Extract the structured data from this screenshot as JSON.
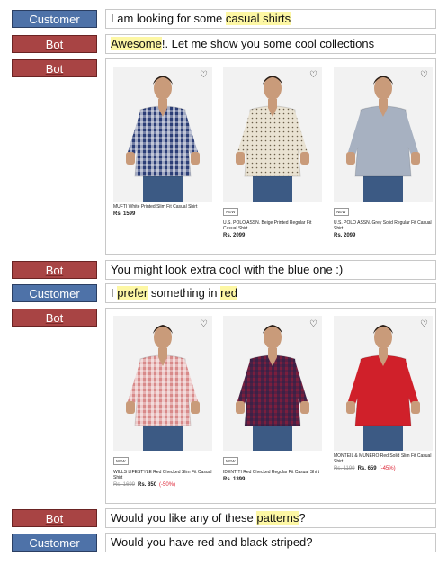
{
  "conversation": [
    {
      "speaker": "Customer",
      "text_parts": [
        "I am looking for some ",
        "casual shirts"
      ]
    },
    {
      "speaker": "Bot",
      "text_parts": [
        "Awesome",
        "!. Let me show you some cool collections"
      ]
    },
    {
      "speaker": "Bot",
      "type": "products"
    },
    {
      "speaker": "Bot",
      "text": "You might look extra cool with the blue one :)"
    },
    {
      "speaker": "Customer",
      "text_parts": [
        "I ",
        "prefer",
        " something in ",
        "red"
      ]
    },
    {
      "speaker": "Bot",
      "type": "products"
    },
    {
      "speaker": "Bot",
      "text_parts": [
        "Would you like any of these ",
        "patterns",
        "?"
      ]
    },
    {
      "speaker": "Customer",
      "text": "Would you have red and black striped?"
    }
  ],
  "products_set1": [
    {
      "name": "MUFTI White Printed Slim Fit Casual Shirt",
      "price": "Rs. 1599",
      "badge": "",
      "shirt_color": "#2c3e77",
      "pattern": "check-blue"
    },
    {
      "name": "U.S. POLO ASSN. Beige Printed Regular Fit Casual Shirt",
      "price": "Rs. 2099",
      "badge": "NEW",
      "shirt_color": "#e9e2d2",
      "pattern": "print-beige"
    },
    {
      "name": "U.S. POLO ASSN. Grey Solid Regular Fit Casual Shirt",
      "price": "Rs. 2099",
      "badge": "NEW",
      "shirt_color": "#a7b1c1",
      "pattern": "solid-grey"
    }
  ],
  "products_set2": [
    {
      "name": "WILLS LIFESTYLE Red Checked Slim Fit Casual Shirt",
      "mrp": "Rs. 1699",
      "price": "Rs. 850",
      "discount": "(-50%)",
      "badge": "NEW",
      "shirt_color": "#d88a8a",
      "pattern": "check-red"
    },
    {
      "name": "IDENTITI Red Checked Regular Fit Casual Shirt",
      "price": "Rs. 1399",
      "badge": "NEW",
      "shirt_color": "#7a1e3e",
      "pattern": "check-maroon"
    },
    {
      "name": "MONTEIL & MUNERO Red Solid Slim Fit Casual Shirt",
      "mrp": "Rs. 1199",
      "price": "Rs. 659",
      "discount": "(-45%)",
      "badge": "",
      "shirt_color": "#d0202a",
      "pattern": "solid-red"
    }
  ],
  "icons": {
    "wishlist": "heart-outline-icon"
  },
  "colors": {
    "customer_label": "#4e72a8",
    "bot_label": "#a84444",
    "highlight": "#fdf7a4"
  }
}
